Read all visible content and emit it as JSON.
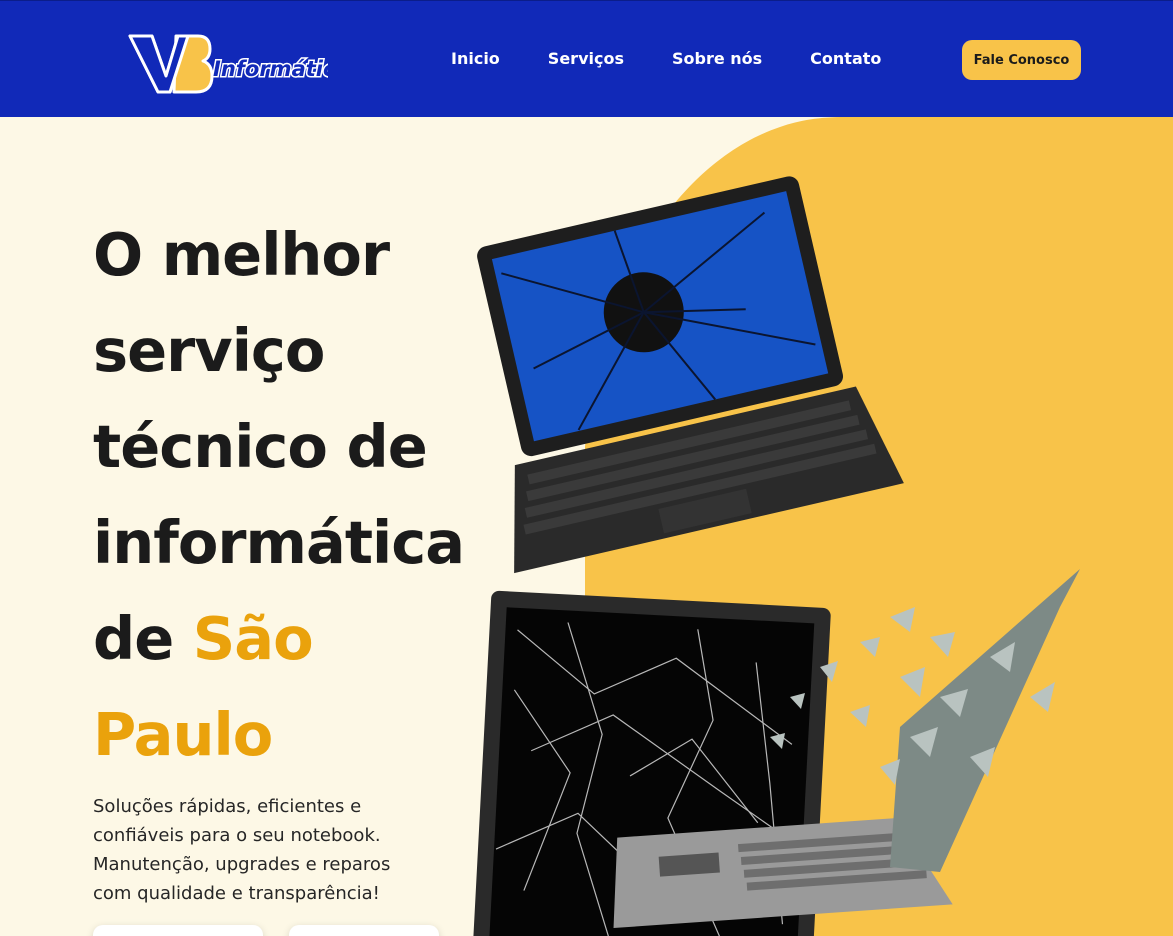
{
  "brand": {
    "logo_letters": "VB",
    "logo_text": "Informática",
    "colors": {
      "blue": "#1129b8",
      "yellow": "#f8c349",
      "accent": "#eaa20c",
      "cream": "#fdf8e6"
    }
  },
  "nav": {
    "items": [
      {
        "label": "Inicio"
      },
      {
        "label": "Serviços"
      },
      {
        "label": "Sobre nós"
      },
      {
        "label": "Contato"
      }
    ],
    "cta_label": "Fale Conosco"
  },
  "hero": {
    "title_lines": [
      "O melhor",
      "serviço",
      "técnico de",
      "informática",
      "de "
    ],
    "title_accent_1": "São",
    "title_accent_2": "Paulo",
    "description": "Soluções rápidas, eficientes e confiáveis para o seu notebook. Manutenção, upgrades e reparos com qualidade e transparência!",
    "image_desc_icons": [
      "broken-laptop-top-icon",
      "broken-laptop-bottom-icon",
      "shattering-laptop-icon"
    ]
  }
}
